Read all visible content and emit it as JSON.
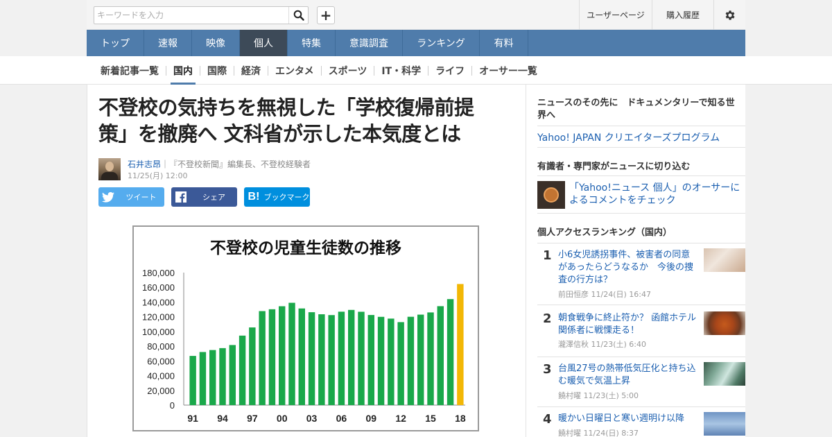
{
  "search": {
    "placeholder": "キーワードを入力"
  },
  "header": {
    "user_page": "ユーザーページ",
    "purchase_history": "購入履歴",
    "add_label": "+"
  },
  "main_nav": [
    {
      "label": "トップ",
      "active": false
    },
    {
      "label": "速報",
      "active": false
    },
    {
      "label": "映像",
      "active": false
    },
    {
      "label": "個人",
      "active": true
    },
    {
      "label": "特集",
      "active": false
    },
    {
      "label": "意識調査",
      "active": false
    },
    {
      "label": "ランキング",
      "active": false
    },
    {
      "label": "有料",
      "active": false
    }
  ],
  "sub_nav": [
    {
      "label": "新着記事一覧",
      "active": false
    },
    {
      "label": "国内",
      "active": true
    },
    {
      "label": "国際",
      "active": false
    },
    {
      "label": "経済",
      "active": false
    },
    {
      "label": "エンタメ",
      "active": false
    },
    {
      "label": "スポーツ",
      "active": false
    },
    {
      "label": "IT・科学",
      "active": false
    },
    {
      "label": "ライフ",
      "active": false
    },
    {
      "label": "オーサー一覧",
      "active": false
    }
  ],
  "article": {
    "title_line1": "不登校の気持ちを無視した「学校復帰前提",
    "title_line2": "策」を撤廃へ 文科省が示した本気度とは",
    "author_name": "石井志昂",
    "author_desc": "｜『不登校新聞』編集長、不登校経験者",
    "date": "11/25(月) 12:00",
    "share": {
      "tweet": "ツイート",
      "facebook": "シェア",
      "hatena": "ブックマーク"
    }
  },
  "chart_data": {
    "type": "bar",
    "title": "不登校の児童生徒数の推移",
    "x": [
      "91",
      "92",
      "93",
      "94",
      "95",
      "96",
      "97",
      "98",
      "99",
      "00",
      "01",
      "02",
      "03",
      "04",
      "05",
      "06",
      "07",
      "08",
      "09",
      "10",
      "11",
      "12",
      "13",
      "14",
      "15",
      "16",
      "17",
      "18"
    ],
    "xtick_labels": [
      "91",
      "94",
      "97",
      "00",
      "03",
      "06",
      "09",
      "12",
      "15",
      "18"
    ],
    "values": [
      66800,
      72100,
      74800,
      77400,
      81600,
      94400,
      105500,
      127700,
      130200,
      134300,
      139000,
      131300,
      126200,
      123400,
      122300,
      126900,
      129300,
      126800,
      122400,
      119900,
      117500,
      112700,
      120000,
      122900,
      125900,
      134400,
      144000,
      164500
    ],
    "ylim": [
      0,
      180000
    ],
    "yticks": [
      0,
      20000,
      40000,
      60000,
      80000,
      100000,
      120000,
      140000,
      160000,
      180000
    ],
    "ytick_labels": [
      "0",
      "20,000",
      "40,000",
      "60,000",
      "80,000",
      "100,000",
      "120,000",
      "140,000",
      "160,000",
      "180,000"
    ],
    "xlabel": "",
    "ylabel": "",
    "bar_color": "#1aa84a",
    "highlight_color": "#f2b705",
    "highlight_index": 27,
    "grid": false
  },
  "sidebar": {
    "doc_heading": "ニュースのその先に　ドキュメンタリーで知る世界へ",
    "creators_link": "Yahoo! JAPAN クリエイターズプログラム",
    "experts_heading": "有識者・専門家がニュースに切り込む",
    "experts_link": "「Yahoo!ニュース 個人」のオーサーによるコメントをチェック",
    "ranking_heading": "個人アクセスランキング（国内）",
    "ranking": [
      {
        "rank": "1",
        "title": "小6女児誘拐事件、被害者の同意があったらどうなるか　今後の捜査の行方は？",
        "author": "前田恒彦",
        "date": "11/24(日) 16:47"
      },
      {
        "rank": "2",
        "title": "朝食戦争に終止符か？ 函館ホテル関係者に戦慄走る！",
        "author": "瀧澤信秋",
        "date": "11/23(土) 6:40"
      },
      {
        "rank": "3",
        "title": "台風27号の熱帯低気圧化と持ち込む暖気で気温上昇",
        "author": "饒村曜",
        "date": "11/23(土) 5:00"
      },
      {
        "rank": "4",
        "title": "暖かい日曜日と寒い週明け以降",
        "author": "饒村曜",
        "date": "11/24(日) 8:37"
      }
    ]
  }
}
